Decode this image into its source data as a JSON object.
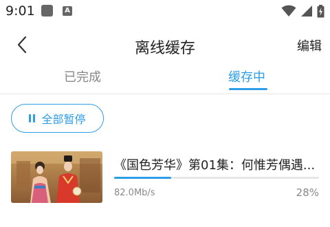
{
  "status_bar": {
    "time": "9:01",
    "notification_letter": "A",
    "icons": [
      "notification-square-icon",
      "text-notification-icon",
      "wifi-icon",
      "signal-icon",
      "battery-icon"
    ]
  },
  "header": {
    "title": "离线缓存",
    "edit_label": "编辑",
    "back_icon": "chevron-left-icon"
  },
  "tabs": [
    {
      "label": "已完成",
      "active": false
    },
    {
      "label": "缓存中",
      "active": true
    }
  ],
  "toolbar": {
    "pause_all_label": "全部暂停"
  },
  "downloads": [
    {
      "title": "《国色芳华》第01集：何惟芳偶遇...",
      "speed": "82.0Mb/s",
      "percent_label": "28%",
      "progress": 0.28
    }
  ],
  "colors": {
    "accent": "#2d9de8",
    "text_primary": "#222222",
    "text_secondary": "#888888",
    "divider": "#e8e8e8"
  }
}
